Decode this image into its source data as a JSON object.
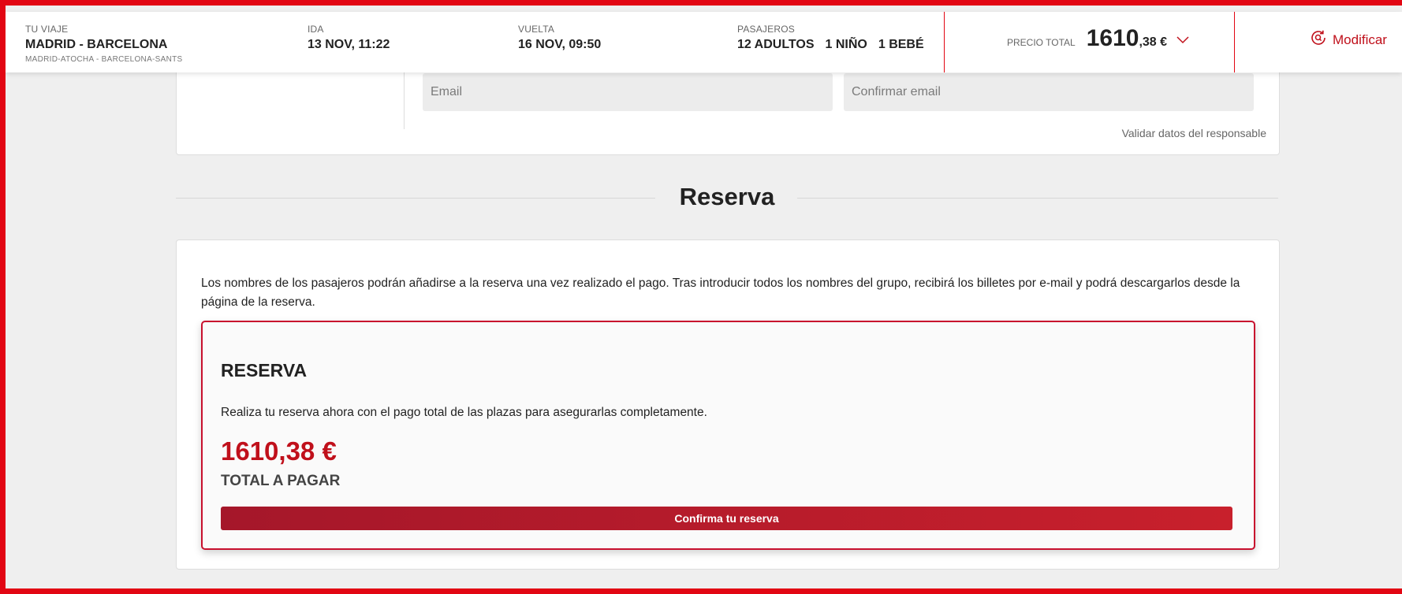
{
  "header": {
    "trip": {
      "label": "TU VIAJE",
      "value": "MADRID - BARCELONA",
      "sub": "MADRID-ATOCHA - BARCELONA-SANTS"
    },
    "outbound": {
      "label": "IDA",
      "value": "13 NOV, 11:22"
    },
    "return": {
      "label": "VUELTA",
      "value": "16 NOV, 09:50"
    },
    "passengers": {
      "label": "PASAJEROS",
      "adults": "12 ADULTOS",
      "children": "1 NIÑO",
      "infants": "1 BEBÉ"
    },
    "price": {
      "label": "PRECIO TOTAL",
      "integer": "1610",
      "decimal": ",38 €"
    },
    "modify_label": "Modificar"
  },
  "contact_form": {
    "email_placeholder": "Email",
    "confirm_email_placeholder": "Confirmar email",
    "validate_link": "Validar datos del responsable"
  },
  "section": {
    "title": "Reserva"
  },
  "booking": {
    "intro": "Los nombres de los pasajeros podrán añadirse a la reserva una vez realizado el pago. Tras introducir todos los nombres del grupo, recibirá los billetes por e-mail y podrá descargarlos desde la página de la reserva.",
    "title": "RESERVA",
    "description": "Realiza tu reserva ahora con el pago total de las plazas para asegurarlas completamente.",
    "amount": "1610,38 €",
    "total_label": "TOTAL A PAGAR",
    "confirm_button": "Confirma tu reserva"
  },
  "colors": {
    "accent": "#c0101b",
    "frame": "#e20613"
  }
}
